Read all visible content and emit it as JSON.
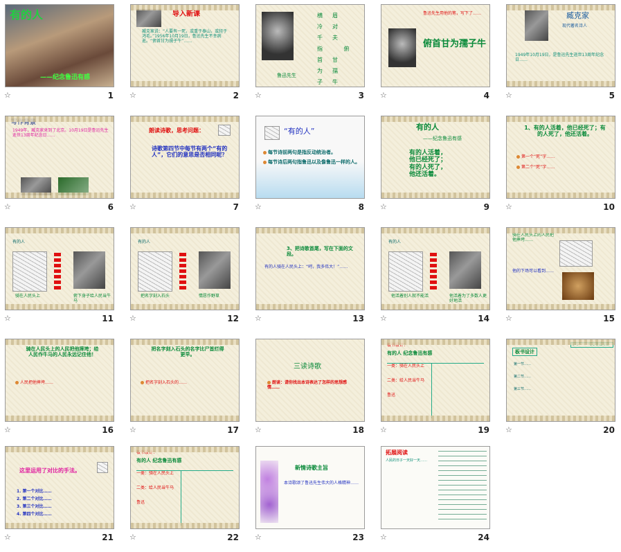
{
  "slides": [
    {
      "num": "1",
      "title": "有的人",
      "subtitle": "——纪念鲁迅有感"
    },
    {
      "num": "2",
      "title": "导入新课",
      "body": "臧克家说：“人要有一死，或重于泰山，或轻于鸿毛。”1956年10月19日，鲁迅先生不幸病逝。“俯首甘为孺子牛”……"
    },
    {
      "num": "3",
      "caption": "鲁迅先生",
      "poem": "横眉冷对千夫指 俯首甘为孺子牛"
    },
    {
      "num": "4",
      "poem": "俯首甘为孺子牛",
      "body": "鲁迅先生用他的笔，写下了……"
    },
    {
      "num": "5",
      "title": "臧克家",
      "subtitle": "现代著名诗人",
      "body": "1949年10月19日，是鲁迅先生逝世13周年纪念日……"
    },
    {
      "num": "6",
      "title": "写作背景",
      "body": "1949年，臧克家来到了北京。10月19日是鲁迅先生逝世13周年纪念日……"
    },
    {
      "num": "7",
      "title": "朗读诗歌，思考问题：",
      "body": "诗歌第四节中每节有两个“有的人”，它们的意思是否相同呢？"
    },
    {
      "num": "8",
      "title": "“有的人”",
      "items": [
        "每节诗前两句是指反动统治者。",
        "每节诗后两句指鲁迅以及像鲁迅一样的人。"
      ]
    },
    {
      "num": "9",
      "title": "有的人",
      "subtitle": "——纪念鲁迅有感",
      "lines": [
        "有的人活着，",
        "他已经死了；",
        "有的人死了，",
        "他还活着。"
      ]
    },
    {
      "num": "10",
      "title": "1、有的人活着，他已经死了；有的人死了，他还活着。",
      "items": [
        "第一个“死”字……",
        "第二个“死”字……"
      ]
    },
    {
      "num": "11",
      "head": "有的人",
      "v1": "骑在人民头上",
      "v2": "俯下身子给人民当牛马"
    },
    {
      "num": "12",
      "head": "有的人",
      "v1": "把名字刻入石头",
      "v2": "情愿作野草"
    },
    {
      "num": "13",
      "title": "3、把诗歌首尾，写在下面的文段。",
      "body": "有的人骑在人民头上：“呵，我多伟大！”……"
    },
    {
      "num": "14",
      "head": "有的人",
      "v1": "他活着别人就不能活",
      "v2": "他活着为了多数人更好地活"
    },
    {
      "num": "15",
      "body": "骑在人民头上的人民把他摔垮……",
      "v2": "他的下场可以看到……"
    },
    {
      "num": "16",
      "body": "骑在人民头上的人民把他摔垮；给人民作牛马的人民永远记住他！",
      "items": [
        "人民把他摔垮……"
      ]
    },
    {
      "num": "17",
      "body": "把名字刻入石头的名字比尸首烂得更早。",
      "items": [
        "把名字刻入石头的……"
      ]
    },
    {
      "num": "18",
      "title": "三读诗歌",
      "items": [
        "朗读：请你找出本诗表达了怎样的思想感情……"
      ]
    },
    {
      "num": "19",
      "title": "板书设计：",
      "subtitle": "有的人 纪念鲁迅有感",
      "rows": [
        "一类：骑在人民头上",
        "二类：给人民当牛马",
        "鲁迅"
      ]
    },
    {
      "num": "20",
      "title": "板书设计",
      "subtitle": "有的人——纪念鲁迅有感",
      "rows": [
        "第一节……",
        "第二节……",
        "第三节……"
      ]
    },
    {
      "num": "21",
      "title": "这里运用了对比的手法。",
      "items": [
        "1. 第一个对比……",
        "2. 第二个对比……",
        "3. 第三个对比……",
        "4. 第四个对比……"
      ]
    },
    {
      "num": "22",
      "title": "板书设计：",
      "subtitle": "有的人 纪念鲁迅有感",
      "rows": [
        "一类：骑在人民头上",
        "二类：给人民当牛马",
        "鲁迅"
      ]
    },
    {
      "num": "23",
      "title": "新情诗歌主旨",
      "body": "本诗歌颂了鲁迅先生伟大的人格精神……"
    },
    {
      "num": "24",
      "title": "拓展阅读",
      "body": "人民的日子一天好一天……"
    }
  ],
  "star_icon_label": "☆",
  "colors": {
    "green": "#0a8a3a",
    "red": "#e01010",
    "blue": "#2030c0",
    "teal": "#10907a",
    "magenta": "#d020a0",
    "brown": "#8a5a20"
  }
}
